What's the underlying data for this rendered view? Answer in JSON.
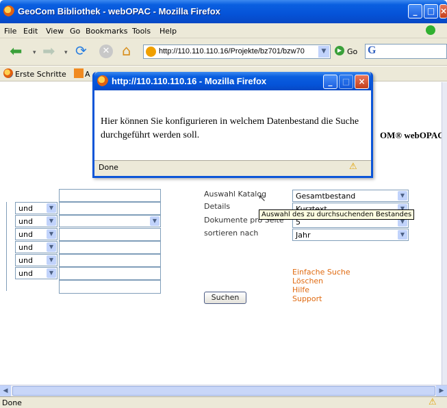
{
  "window": {
    "title": "GeoCom Bibliothek - webOPAC - Mozilla Firefox",
    "menu": [
      "File",
      "Edit",
      "View",
      "Go",
      "Bookmarks",
      "Tools",
      "Help"
    ],
    "url": "http://110.110.110.16/Projekte/bz701/bzw70",
    "go_label": "Go",
    "bookmarks": [
      "Erste Schritte",
      "A"
    ],
    "status": "Done"
  },
  "popup": {
    "title": "http://110.110.110.16 - Mozilla Firefox",
    "message": "Hier können Sie konfigurieren in welchem Datenbestand die Suche durchgeführt werden soll.",
    "status": "Done"
  },
  "page": {
    "brand": "OM® webOPAC",
    "operator_rows": [
      "und",
      "und",
      "und",
      "und",
      "und",
      "und"
    ],
    "options": {
      "katalog_label": "Auswahl Katalog",
      "katalog_value": "Gesamtbestand",
      "details_label": "Details",
      "details_value": "Kurztext",
      "dokumente_label": "Dokumente pro Seite",
      "dokumente_value": "5",
      "sortieren_label": "sortieren nach",
      "sortieren_value": "Jahr"
    },
    "tooltip": "Auswahl des zu durchsuchenden Bestandes",
    "links": [
      "Einfache Suche",
      "Löschen",
      "Hilfe",
      "Support"
    ],
    "search_button": "Suchen"
  }
}
